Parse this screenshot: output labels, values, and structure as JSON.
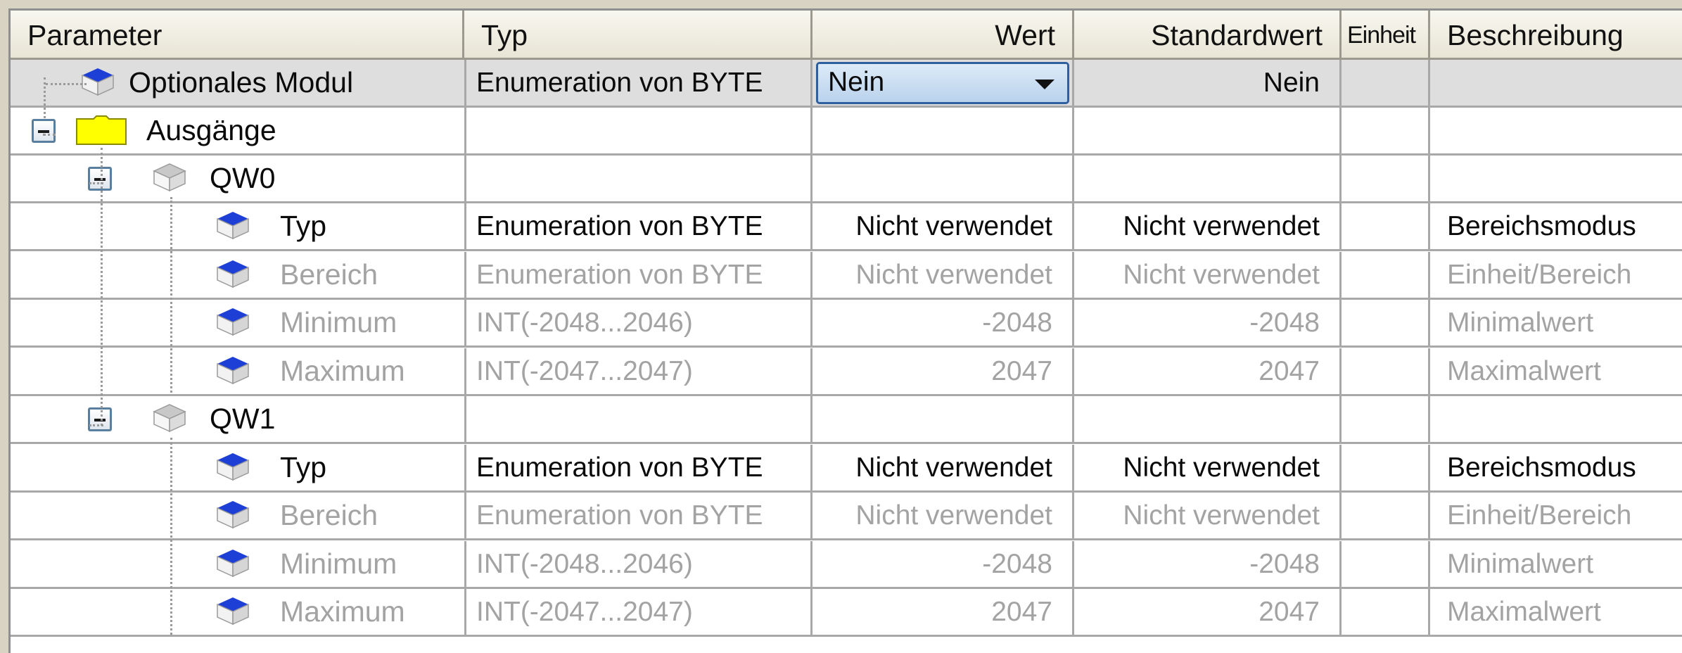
{
  "header": {
    "parameter": "Parameter",
    "typ": "Typ",
    "wert": "Wert",
    "standardwert": "Standardwert",
    "einheit": "Einheit",
    "beschreibung": "Beschreibung"
  },
  "rows": [
    {
      "param": "Optionales Modul",
      "typ": "Enumeration von BYTE",
      "wert": "Nein",
      "standard": "Nein",
      "einheit": "",
      "beschreibung": ""
    },
    {
      "param": "Ausgänge",
      "typ": "",
      "wert": "",
      "standard": "",
      "einheit": "",
      "beschreibung": ""
    },
    {
      "param": "QW0",
      "typ": "",
      "wert": "",
      "standard": "",
      "einheit": "",
      "beschreibung": ""
    },
    {
      "param": "Typ",
      "typ": "Enumeration von BYTE",
      "wert": "Nicht verwendet",
      "standard": "Nicht verwendet",
      "einheit": "",
      "beschreibung": "Bereichsmodus"
    },
    {
      "param": "Bereich",
      "typ": "Enumeration von BYTE",
      "wert": "Nicht verwendet",
      "standard": "Nicht verwendet",
      "einheit": "",
      "beschreibung": "Einheit/Bereich"
    },
    {
      "param": "Minimum",
      "typ": "INT(-2048...2046)",
      "wert": "-2048",
      "standard": "-2048",
      "einheit": "",
      "beschreibung": "Minimalwert"
    },
    {
      "param": "Maximum",
      "typ": "INT(-2047...2047)",
      "wert": "2047",
      "standard": "2047",
      "einheit": "",
      "beschreibung": "Maximalwert"
    },
    {
      "param": "QW1",
      "typ": "",
      "wert": "",
      "standard": "",
      "einheit": "",
      "beschreibung": ""
    },
    {
      "param": "Typ",
      "typ": "Enumeration von BYTE",
      "wert": "Nicht verwendet",
      "standard": "Nicht verwendet",
      "einheit": "",
      "beschreibung": "Bereichsmodus"
    },
    {
      "param": "Bereich",
      "typ": "Enumeration von BYTE",
      "wert": "Nicht verwendet",
      "standard": "Nicht verwendet",
      "einheit": "",
      "beschreibung": "Einheit/Bereich"
    },
    {
      "param": "Minimum",
      "typ": "INT(-2048...2046)",
      "wert": "-2048",
      "standard": "-2048",
      "einheit": "",
      "beschreibung": "Minimalwert"
    },
    {
      "param": "Maximum",
      "typ": "INT(-2047...2047)",
      "wert": "2047",
      "standard": "2047",
      "einheit": "",
      "beschreibung": "Maximalwert"
    }
  ],
  "colors": {
    "header_bg": "#ece9d8",
    "selected_row": "#dedede",
    "disabled_text": "#a3a3a3",
    "dropdown_bg": "#c9ddf2",
    "dropdown_border": "#2f5f9f",
    "folder_fill": "#ffff00",
    "param_icon_blue": "#1e3fd6"
  },
  "icons": {
    "parameter": "blue-cube-icon",
    "folder": "folder-icon",
    "channel": "gray-cube-icon",
    "expander": "collapse-minus-icon",
    "dropdown_arrow": "chevron-down-icon"
  }
}
